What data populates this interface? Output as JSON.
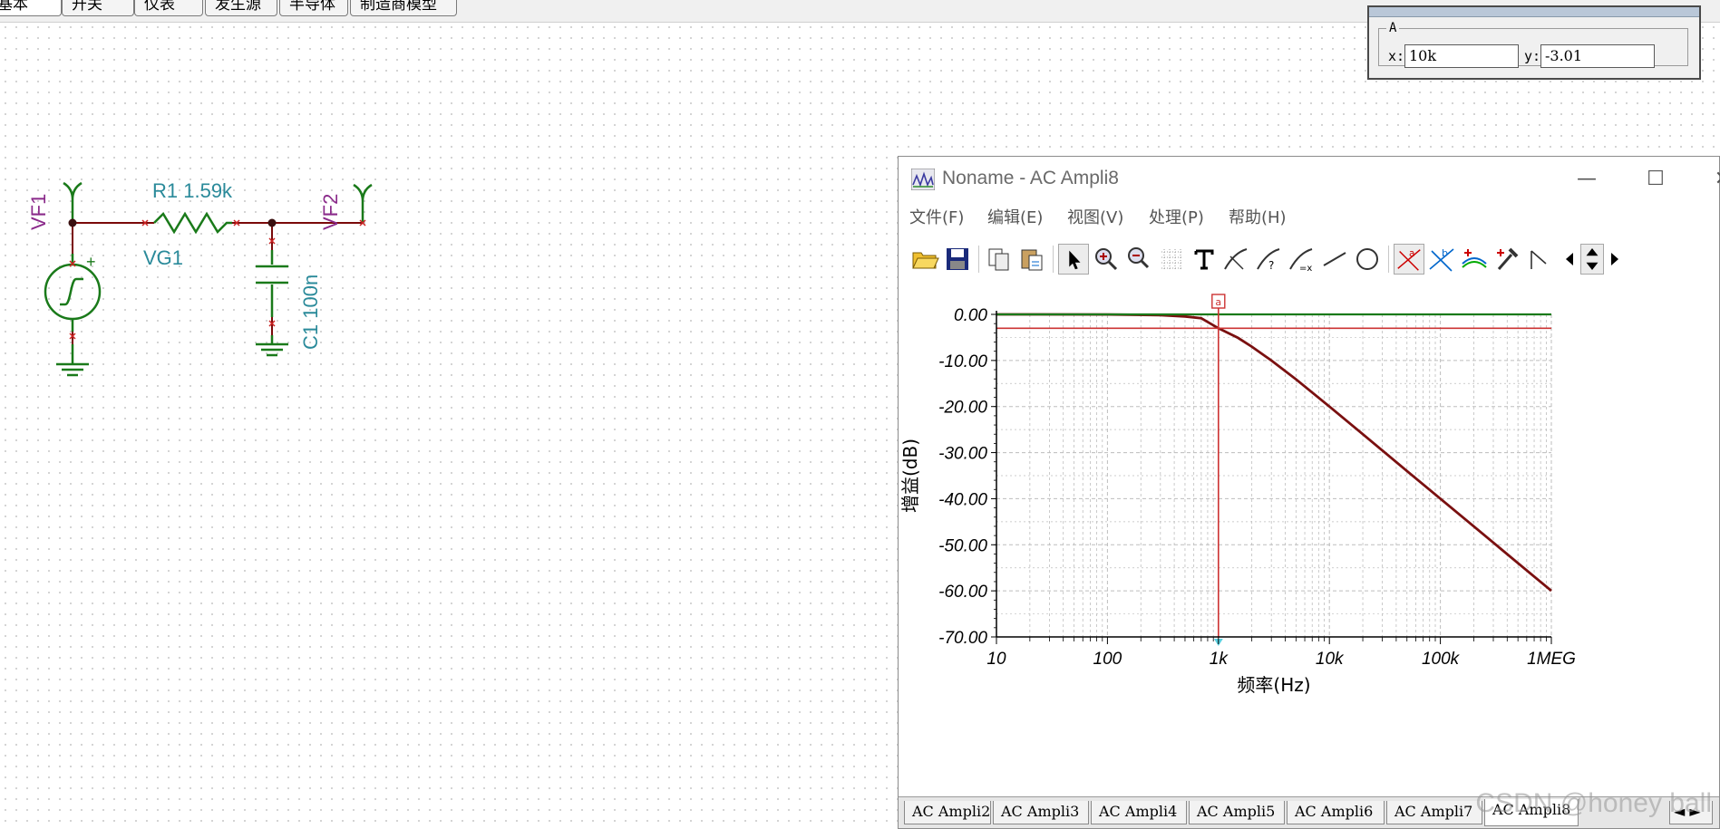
{
  "component_tabs": [
    "基本",
    "开关",
    "仪表",
    "发生源",
    "半导体",
    "制造商模型"
  ],
  "cursor_box": {
    "name": "A",
    "x_label": "x:",
    "x_value": "10k",
    "y_label": "y:",
    "y_value": "-3.01"
  },
  "schematic": {
    "vf1": "VF1",
    "vf2": "VF2",
    "r1": "R1 1.59k",
    "vg1": "VG1",
    "c1": "C1 100n",
    "plus": "+"
  },
  "window": {
    "title": "Noname - AC Ampli8",
    "controls": {
      "minimize": "—",
      "maximize": "☐",
      "close": "✕"
    },
    "menu": [
      "文件(F)",
      "编辑(E)",
      "视图(V)",
      "处理(P)",
      "帮助(H)"
    ],
    "toolbar_icons": [
      "open-folder-icon",
      "save-icon",
      "copy-icon",
      "paste-icon",
      "pointer-icon",
      "zoom-in-icon",
      "zoom-100-icon",
      "grid-icon",
      "text-icon",
      "marker-cursor-icon",
      "help-marker-icon",
      "equation-icon",
      "line-icon",
      "circle-icon",
      "cursor-a-icon",
      "cursor-b-icon",
      "add-curve-icon",
      "probe-icon",
      "corner-icon",
      "scroll-left-icon",
      "scroll-updown-icon",
      "scroll-right-icon"
    ],
    "bottom_tabs": [
      "AC Ampli2",
      "AC Ampli3",
      "AC Ampli4",
      "AC Ampli5",
      "AC Ampli6",
      "AC Ampli7",
      "AC Ampli8"
    ],
    "active_tab": "AC Ampli8",
    "nav_arrows": "◄ ►"
  },
  "watermark": "CSDN @honey ball",
  "colors": {
    "curve": "#7a1010",
    "flat_curve": "#1a7a1a",
    "cursor": "#cc3333",
    "grid": "#bdbdbd",
    "schematic_wire": "#7a0a0a",
    "component": "#1a7a1a",
    "label_teal": "#2a8a9a",
    "label_purple": "#8a2a8a"
  },
  "chart_data": {
    "type": "line",
    "xlabel": "频率(Hz)",
    "ylabel": "增益(dB)",
    "xscale": "log",
    "xlim": [
      10,
      1000000
    ],
    "ylim": [
      -70,
      0
    ],
    "x_ticks": [
      10,
      100,
      1000,
      10000,
      100000,
      1000000
    ],
    "x_tick_labels": [
      "10",
      "100",
      "1k",
      "10k",
      "100k",
      "1MEG"
    ],
    "y_ticks": [
      0,
      -10,
      -20,
      -30,
      -40,
      -50,
      -60,
      -70
    ],
    "y_tick_labels": [
      "0.00",
      "-10.00",
      "-20.00",
      "-30.00",
      "-40.00",
      "-50.00",
      "-60.00",
      "-70.00"
    ],
    "grid": true,
    "cursor": {
      "label": "a",
      "x": 1000,
      "y": -3.01
    },
    "series": [
      {
        "color": "#7a1010",
        "x": [
          10,
          100,
          300,
          500,
          700,
          1000,
          1500,
          2000,
          3000,
          5000,
          10000,
          20000,
          50000,
          100000,
          200000,
          500000,
          1000000
        ],
        "y": [
          0,
          -0.02,
          -0.15,
          -0.45,
          -0.83,
          -3.01,
          -5.1,
          -7.0,
          -10.0,
          -14.1,
          -20.0,
          -26.0,
          -34.0,
          -40.0,
          -46.0,
          -54.0,
          -60.0
        ]
      },
      {
        "color": "#1a7a1a",
        "x": [
          10,
          1000000
        ],
        "y": [
          0,
          0
        ]
      }
    ]
  }
}
